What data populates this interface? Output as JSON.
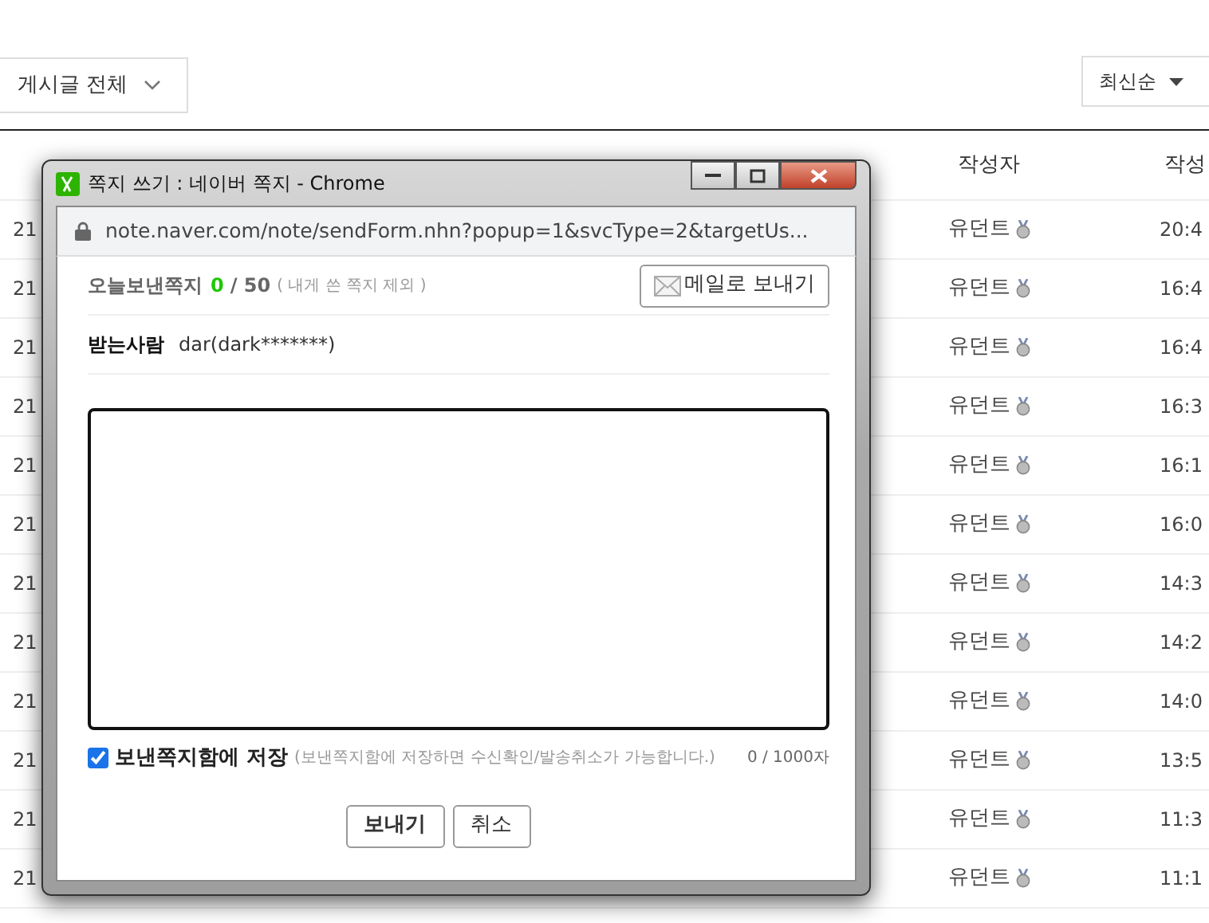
{
  "filter": {
    "label": "게시글 전체"
  },
  "sort": {
    "label": "최신순"
  },
  "table": {
    "columns": [
      "작성자",
      "작성"
    ],
    "rows": [
      {
        "column_1": "21",
        "author": "유던트",
        "time": "20:4"
      },
      {
        "column_1": "21",
        "author": "유던트",
        "time": "16:4"
      },
      {
        "column_1": "21",
        "author": "유던트",
        "time": "16:4"
      },
      {
        "column_1": "21",
        "author": "유던트",
        "time": "16:3"
      },
      {
        "column_1": "21",
        "author": "유던트",
        "time": "16:1"
      },
      {
        "column_1": "21",
        "author": "유던트",
        "time": "16:0"
      },
      {
        "column_1": "21",
        "author": "유던트",
        "time": "14:3"
      },
      {
        "column_1": "21",
        "author": "유던트",
        "time": "14:2"
      },
      {
        "column_1": "21",
        "author": "유던트",
        "time": "14:0"
      },
      {
        "column_1": "21",
        "author": "유던트",
        "time": "13:5"
      },
      {
        "column_1": "21",
        "author": "유던트",
        "time": "11:3"
      },
      {
        "column_1": "21",
        "author": "유던트",
        "time": "11:1"
      }
    ]
  },
  "popup": {
    "window": {
      "title": "쪽지 쓰기 : 네이버 쪽지 - Chrome"
    },
    "url": "note.naver.com/note/sendForm.nhn?popup=1&svcType=2&targetUs...",
    "sent_today": {
      "label": "오늘보낸쪽지",
      "count": "0",
      "limit": "/ 50",
      "note": "( 내게 쓴 쪽지 제외 )"
    },
    "email_button": "메일로 보내기",
    "recipient": {
      "label": "받는사람",
      "value": "dar(dark*******)"
    },
    "save": {
      "label": "보낸쪽지함에 저장",
      "hint": "(보낸쪽지함에 저장하면 수신확인/발송취소가 가능합니다.)",
      "checked": true
    },
    "char_count": "0 / 1000자",
    "buttons": [
      {
        "label": "보내기",
        "kind": "primary"
      },
      {
        "label": "취소",
        "kind": "secondary"
      }
    ]
  }
}
